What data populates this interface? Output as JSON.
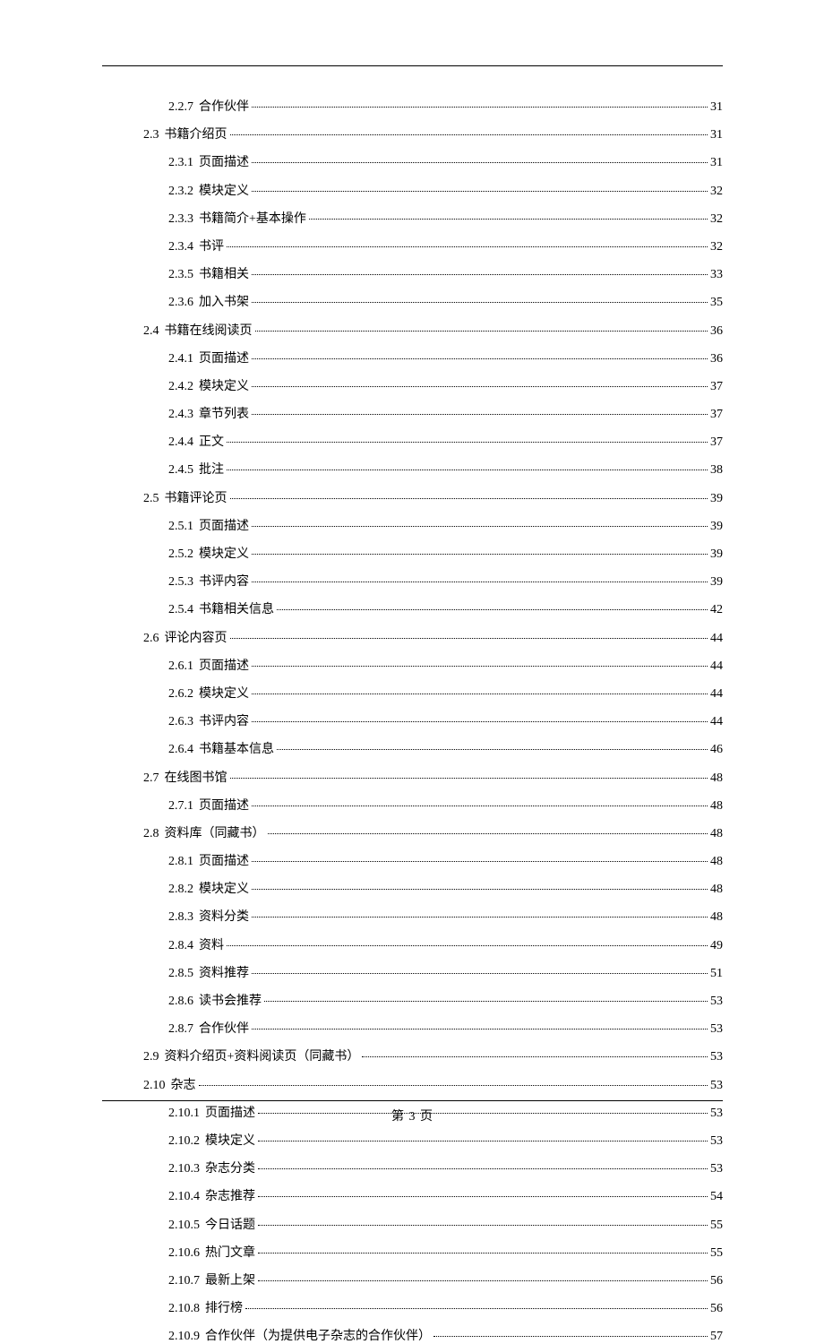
{
  "footer": "第 3 页",
  "toc": [
    {
      "level": 3,
      "num": "2.2.7",
      "title": "合作伙伴",
      "page": "31"
    },
    {
      "level": 2,
      "num": "2.3",
      "title": "书籍介绍页",
      "page": "31"
    },
    {
      "level": 3,
      "num": "2.3.1",
      "title": "页面描述",
      "page": "31"
    },
    {
      "level": 3,
      "num": "2.3.2",
      "title": "模块定义",
      "page": "32"
    },
    {
      "level": 3,
      "num": "2.3.3",
      "title": "书籍简介+基本操作",
      "page": "32"
    },
    {
      "level": 3,
      "num": "2.3.4",
      "title": "书评",
      "page": "32"
    },
    {
      "level": 3,
      "num": "2.3.5",
      "title": "书籍相关",
      "page": "33"
    },
    {
      "level": 3,
      "num": "2.3.6",
      "title": "加入书架",
      "page": "35"
    },
    {
      "level": 2,
      "num": "2.4",
      "title": "书籍在线阅读页",
      "page": "36"
    },
    {
      "level": 3,
      "num": "2.4.1",
      "title": "页面描述",
      "page": "36"
    },
    {
      "level": 3,
      "num": "2.4.2",
      "title": "模块定义",
      "page": "37"
    },
    {
      "level": 3,
      "num": "2.4.3",
      "title": "章节列表",
      "page": "37"
    },
    {
      "level": 3,
      "num": "2.4.4",
      "title": "正文",
      "page": "37"
    },
    {
      "level": 3,
      "num": "2.4.5",
      "title": "批注",
      "page": "38"
    },
    {
      "level": 2,
      "num": "2.5",
      "title": "书籍评论页",
      "page": "39"
    },
    {
      "level": 3,
      "num": "2.5.1",
      "title": "页面描述",
      "page": "39"
    },
    {
      "level": 3,
      "num": "2.5.2",
      "title": "模块定义",
      "page": "39"
    },
    {
      "level": 3,
      "num": "2.5.3",
      "title": "书评内容",
      "page": "39"
    },
    {
      "level": 3,
      "num": "2.5.4",
      "title": "书籍相关信息",
      "page": "42"
    },
    {
      "level": 2,
      "num": "2.6",
      "title": "评论内容页",
      "page": "44"
    },
    {
      "level": 3,
      "num": "2.6.1",
      "title": "页面描述",
      "page": "44"
    },
    {
      "level": 3,
      "num": "2.6.2",
      "title": "模块定义",
      "page": "44"
    },
    {
      "level": 3,
      "num": "2.6.3",
      "title": "书评内容",
      "page": "44"
    },
    {
      "level": 3,
      "num": "2.6.4",
      "title": "书籍基本信息",
      "page": "46"
    },
    {
      "level": 2,
      "num": "2.7",
      "title": "在线图书馆",
      "page": "48"
    },
    {
      "level": 3,
      "num": "2.7.1",
      "title": "页面描述",
      "page": "48"
    },
    {
      "level": 2,
      "num": "2.8",
      "title": "资料库（同藏书）",
      "page": "48"
    },
    {
      "level": 3,
      "num": "2.8.1",
      "title": "页面描述",
      "page": "48"
    },
    {
      "level": 3,
      "num": "2.8.2",
      "title": "模块定义",
      "page": "48"
    },
    {
      "level": 3,
      "num": "2.8.3",
      "title": "资料分类",
      "page": "48"
    },
    {
      "level": 3,
      "num": "2.8.4",
      "title": "资料",
      "page": "49"
    },
    {
      "level": 3,
      "num": "2.8.5",
      "title": "资料推荐",
      "page": "51"
    },
    {
      "level": 3,
      "num": "2.8.6",
      "title": "读书会推荐",
      "page": "53"
    },
    {
      "level": 3,
      "num": "2.8.7",
      "title": "合作伙伴",
      "page": "53"
    },
    {
      "level": 2,
      "num": "2.9",
      "title": "资料介绍页+资料阅读页（同藏书）",
      "page": "53"
    },
    {
      "level": 2,
      "num": "2.10",
      "title": "杂志",
      "page": "53"
    },
    {
      "level": 3,
      "num": "2.10.1",
      "title": "页面描述",
      "page": "53"
    },
    {
      "level": 3,
      "num": "2.10.2",
      "title": "模块定义",
      "page": "53"
    },
    {
      "level": 3,
      "num": "2.10.3",
      "title": "杂志分类",
      "page": "53"
    },
    {
      "level": 3,
      "num": "2.10.4",
      "title": "杂志推荐",
      "page": "54"
    },
    {
      "level": 3,
      "num": "2.10.5",
      "title": "今日话题",
      "page": "55"
    },
    {
      "level": 3,
      "num": "2.10.6",
      "title": "热门文章",
      "page": "55"
    },
    {
      "level": 3,
      "num": "2.10.7",
      "title": "最新上架",
      "page": "56"
    },
    {
      "level": 3,
      "num": "2.10.8",
      "title": "排行榜",
      "page": "56"
    },
    {
      "level": 3,
      "num": "2.10.9",
      "title": "合作伙伴（为提供电子杂志的合作伙伴）",
      "page": "57"
    }
  ]
}
